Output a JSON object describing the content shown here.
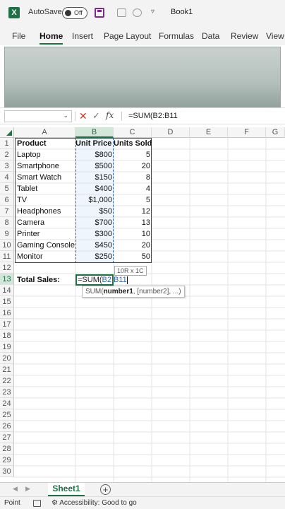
{
  "app": {
    "logo_letter": "X",
    "autosave_label": "AutoSave",
    "autosave_state": "Off",
    "book_title": "Book1"
  },
  "ribbon_tabs": [
    "File",
    "Home",
    "Insert",
    "Page Layout",
    "Formulas",
    "Data",
    "Review",
    "View"
  ],
  "active_tab": "Home",
  "formula_bar": {
    "name_box": "",
    "fx": "fx",
    "formula": "=SUM(B2:B11"
  },
  "columns": [
    "A",
    "B",
    "C",
    "D",
    "E",
    "F",
    "G"
  ],
  "rows": [
    "1",
    "2",
    "3",
    "4",
    "5",
    "6",
    "7",
    "8",
    "9",
    "10",
    "11",
    "12",
    "13",
    "14",
    "15",
    "16",
    "17",
    "18",
    "19",
    "20",
    "21",
    "22",
    "23",
    "24",
    "25",
    "26",
    "27",
    "28",
    "29",
    "30"
  ],
  "table": {
    "headers": [
      "Product",
      "Unit Price",
      "Units Sold"
    ],
    "data": [
      [
        "Laptop",
        "$800",
        "5"
      ],
      [
        "Smartphone",
        "$500",
        "20"
      ],
      [
        "Smart Watch",
        "$150",
        "8"
      ],
      [
        "Tablet",
        "$400",
        "4"
      ],
      [
        "TV",
        "$1,000",
        "5"
      ],
      [
        "Headphones",
        "$50",
        "12"
      ],
      [
        "Camera",
        "$700",
        "13"
      ],
      [
        "Printer",
        "$300",
        "10"
      ],
      [
        "Gaming Console",
        "$450",
        "20"
      ],
      [
        "Monitor",
        "$250",
        "50"
      ]
    ],
    "total_label": "Total Sales:",
    "edit_prefix": "=SUM(",
    "edit_ref": "B2:B11"
  },
  "tooltips": {
    "size": "10R x 1C",
    "fn_name": "SUM(",
    "fn_arg_bold": "number1",
    "fn_rest": ", [number2], ...)"
  },
  "sheets": [
    "Sheet1"
  ],
  "status": {
    "mode": "Point",
    "accessibility": "Accessibility: Good to go"
  }
}
